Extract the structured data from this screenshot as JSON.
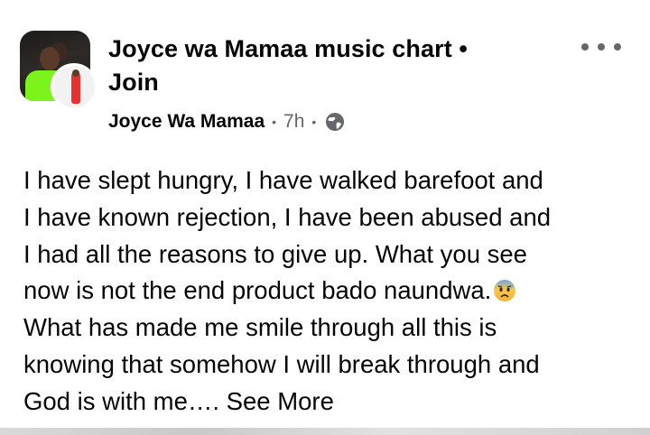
{
  "post": {
    "group_name": "Joyce wa Mamaa music chart",
    "separator": "•",
    "join_label": "Join",
    "author": "Joyce Wa Mamaa",
    "time": "7h",
    "audience_icon": "globe-icon",
    "more_icon": "more-options-icon",
    "text_lines": [
      "I have slept hungry, I have walked barefoot and",
      "I have known rejection, I have been abused and",
      "I had all the reasons to give up. What you see",
      "now is not the end product bado naundwa.",
      "What has made me smile through all this is",
      "knowing that somehow I will break through and",
      "God is with me…."
    ],
    "emoji": "anxious-face-with-sweat-emoji",
    "see_more_label": "See More"
  },
  "colors": {
    "text": "#050505",
    "secondary": "#65676b",
    "background": "#ffffff"
  }
}
